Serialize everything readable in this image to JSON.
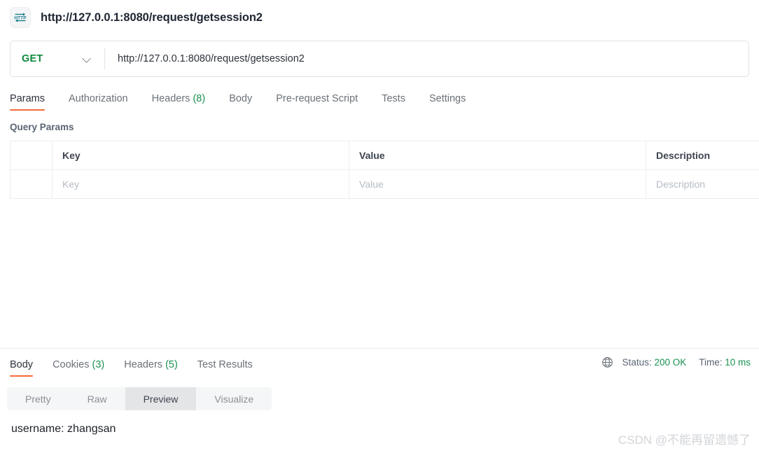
{
  "window": {
    "icon_name": "http-protocol-icon",
    "title": "http://127.0.0.1:8080/request/getsession2"
  },
  "request": {
    "method": "GET",
    "method_dropdown_icon": "chevron-down-icon",
    "url_value": "http://127.0.0.1:8080/request/getsession2",
    "url_placeholder": "Enter request URL",
    "tabs": [
      {
        "label": "Params",
        "count": "",
        "active": true
      },
      {
        "label": "Authorization",
        "count": "",
        "active": false
      },
      {
        "label": "Headers",
        "count": "(8)",
        "active": false
      },
      {
        "label": "Body",
        "count": "",
        "active": false
      },
      {
        "label": "Pre-request Script",
        "count": "",
        "active": false
      },
      {
        "label": "Tests",
        "count": "",
        "active": false
      },
      {
        "label": "Settings",
        "count": "",
        "active": false
      }
    ],
    "query_params": {
      "section_title": "Query Params",
      "columns": [
        "",
        "Key",
        "Value",
        "Description"
      ],
      "rows": [
        {
          "check": "",
          "key": "Key",
          "value": "Value",
          "description": "Description"
        }
      ]
    }
  },
  "response": {
    "tabs": [
      {
        "label": "Body",
        "count": "",
        "active": true
      },
      {
        "label": "Cookies",
        "count": "(3)",
        "active": false
      },
      {
        "label": "Headers",
        "count": "(5)",
        "active": false
      },
      {
        "label": "Test Results",
        "count": "",
        "active": false
      }
    ],
    "meta": {
      "globe_icon": "globe-icon",
      "status_label": "Status:",
      "status_value": "200 OK",
      "time_label": "Time:",
      "time_value": "10 ms"
    },
    "view_modes": [
      {
        "label": "Pretty",
        "active": false
      },
      {
        "label": "Raw",
        "active": false
      },
      {
        "label": "Preview",
        "active": true
      },
      {
        "label": "Visualize",
        "active": false
      }
    ],
    "body_text": "username: zhangsan"
  },
  "watermark": "CSDN @不能再留遗憾了",
  "colors": {
    "method_green": "#0d8a3c",
    "accent_orange": "#f26b3a",
    "count_green": "#1a9150",
    "status_green": "#1a9150",
    "icon_teal": "#1b7f8e"
  }
}
